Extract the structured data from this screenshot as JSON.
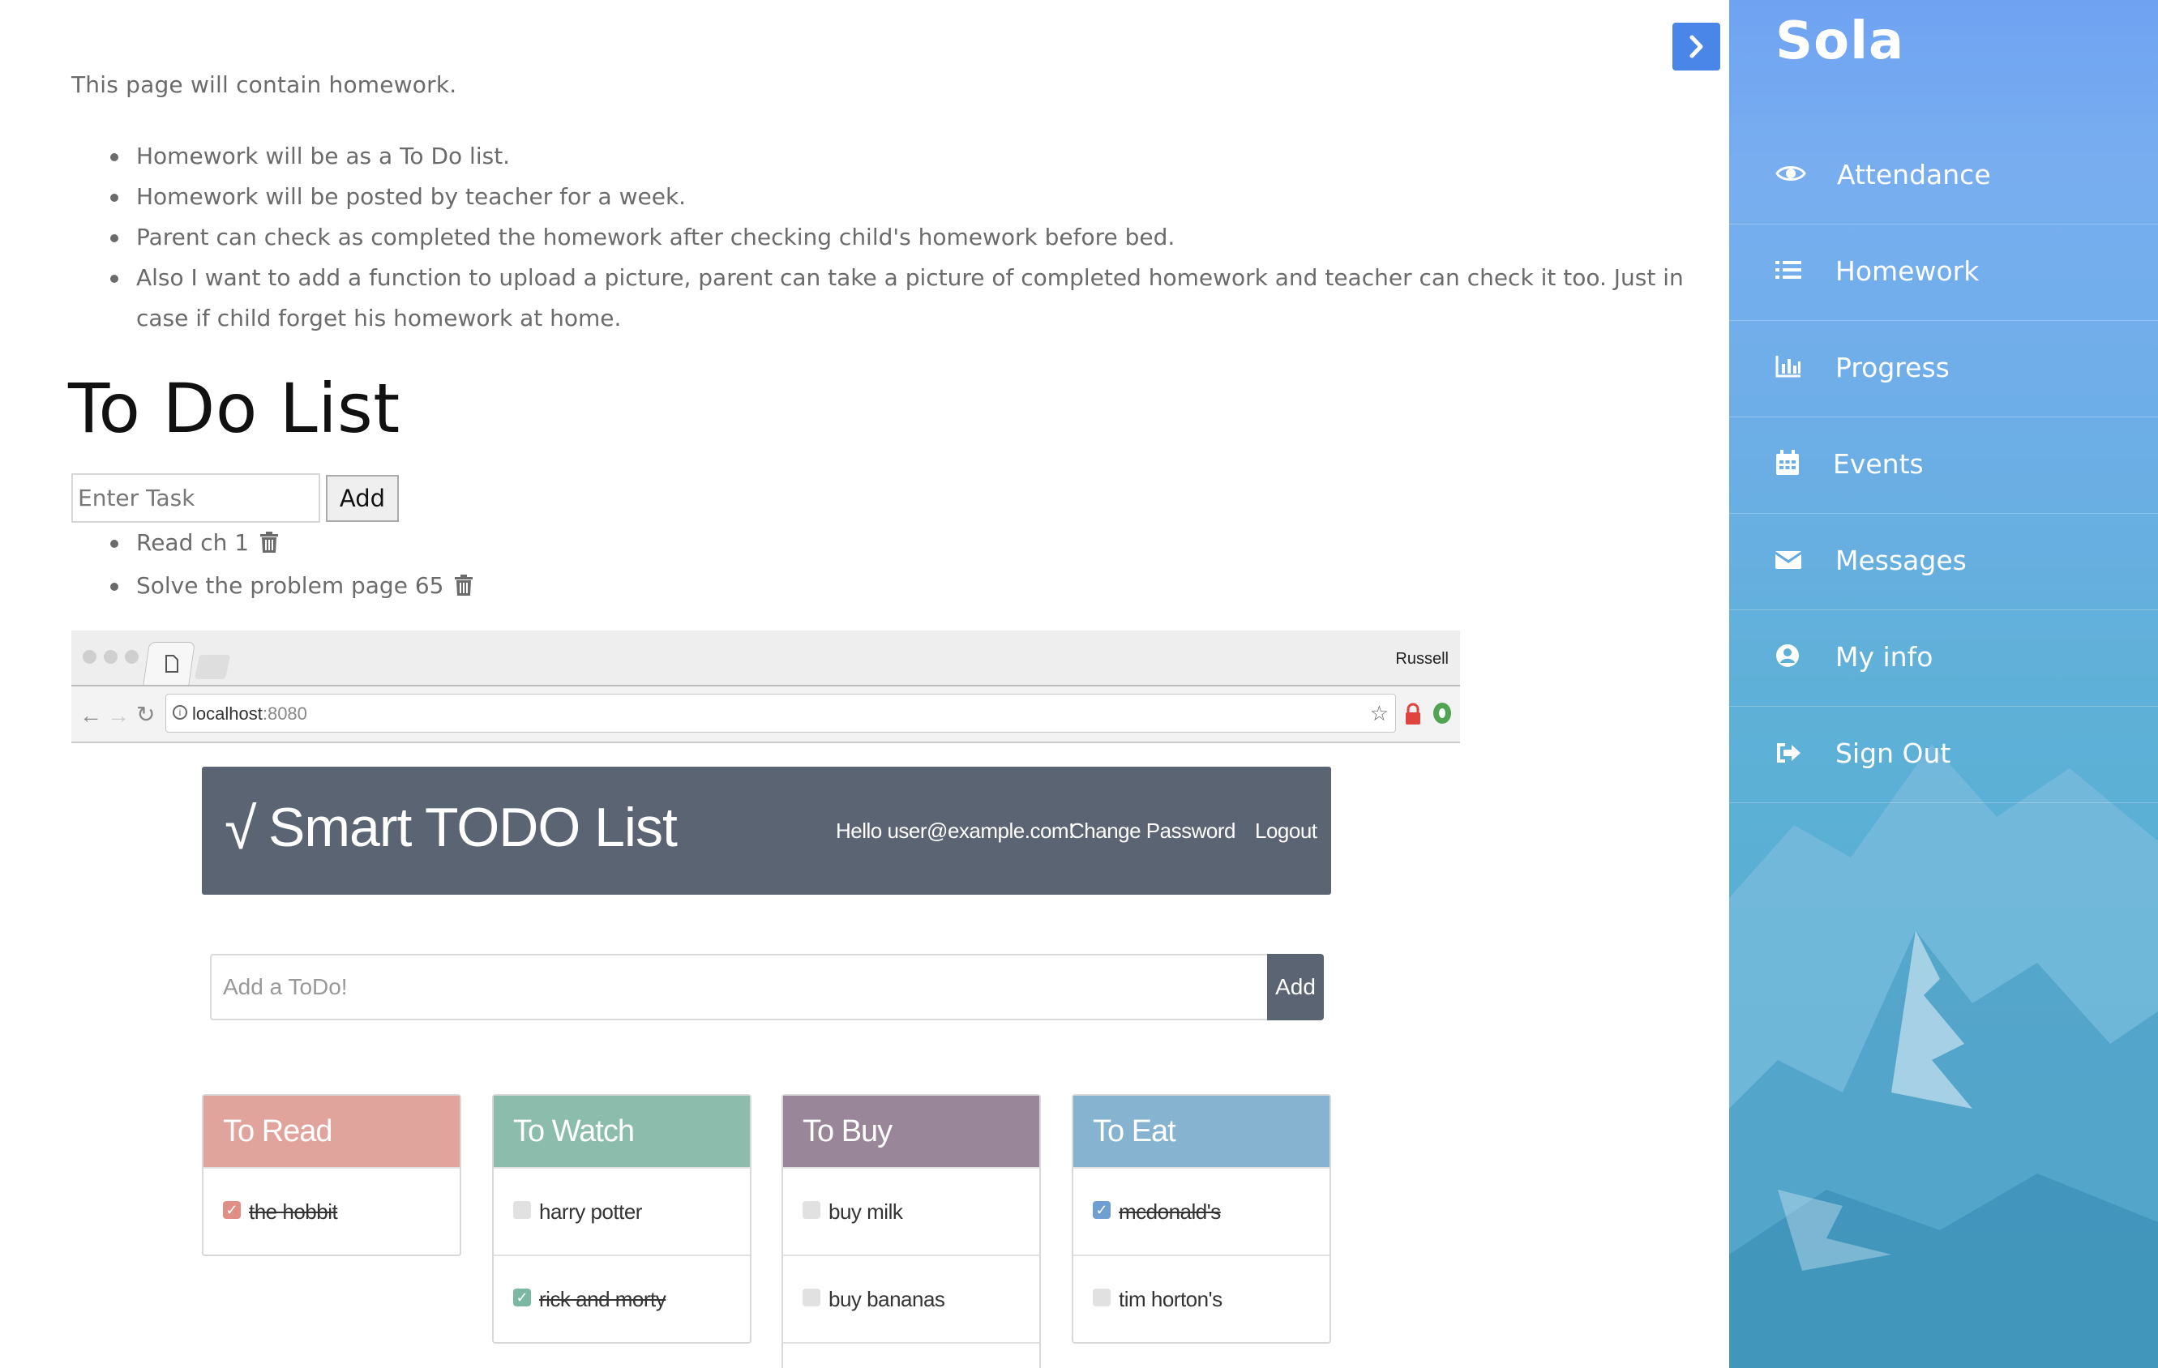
{
  "page": {
    "intro": "This page will contain homework.",
    "bullets": [
      "Homework will be as a To Do list.",
      "Homework will be posted by teacher for a week.",
      "Parent can check as completed the homework after checking child's homework before bed.",
      "Also I want to add a function to upload a picture, parent can take a picture of completed homework and teacher can check it too. Just in case if child forget his homework at home."
    ],
    "todo_title": "To Do List",
    "task_input_placeholder": "Enter Task",
    "add_label": "Add",
    "tasks": [
      "Read ch 1",
      "Solve the problem page 65"
    ]
  },
  "screenshot": {
    "profile_name": "Russell",
    "url_host": "localhost",
    "url_port": ":8080",
    "app_title": "Smart TODO List",
    "check_glyph": "√",
    "hello": "Hello user@example.com!",
    "change_password": "Change Password",
    "logout": "Logout",
    "add_todo_placeholder": "Add a ToDo!",
    "add_todo_label": "Add",
    "cards": [
      {
        "title": "To Read",
        "color": "#e0a49c",
        "items": [
          {
            "text": "the hobbit",
            "done": true
          }
        ]
      },
      {
        "title": "To Watch",
        "color": "#8cbcac",
        "items": [
          {
            "text": "harry potter",
            "done": false
          },
          {
            "text": "rick and morty",
            "done": true
          }
        ]
      },
      {
        "title": "To Buy",
        "color": "#9a8699",
        "items": [
          {
            "text": "buy milk",
            "done": false
          },
          {
            "text": "buy bananas",
            "done": false
          }
        ]
      },
      {
        "title": "To Eat",
        "color": "#86b3cf",
        "items": [
          {
            "text": "mcdonald's",
            "done": true
          },
          {
            "text": "tim horton's",
            "done": false
          }
        ]
      }
    ],
    "check_colors": {
      "To Read": "#e08f86",
      "To Watch": "#7cb7a4",
      "To Eat": "#6f9fd0"
    }
  },
  "sidebar": {
    "brand": "Sola",
    "toggle_icon": "chevron-right-icon",
    "items": [
      {
        "label": "Attendance",
        "icon": "eye-icon"
      },
      {
        "label": "Homework",
        "icon": "list-icon"
      },
      {
        "label": "Progress",
        "icon": "bar-chart-icon"
      },
      {
        "label": "Events",
        "icon": "calendar-icon"
      },
      {
        "label": "Messages",
        "icon": "envelope-icon"
      },
      {
        "label": "My info",
        "icon": "user-circle-icon"
      },
      {
        "label": "Sign Out",
        "icon": "sign-out-icon"
      }
    ]
  },
  "colors": {
    "accent": "#4a86e8",
    "header_bg": "#5a6473"
  }
}
